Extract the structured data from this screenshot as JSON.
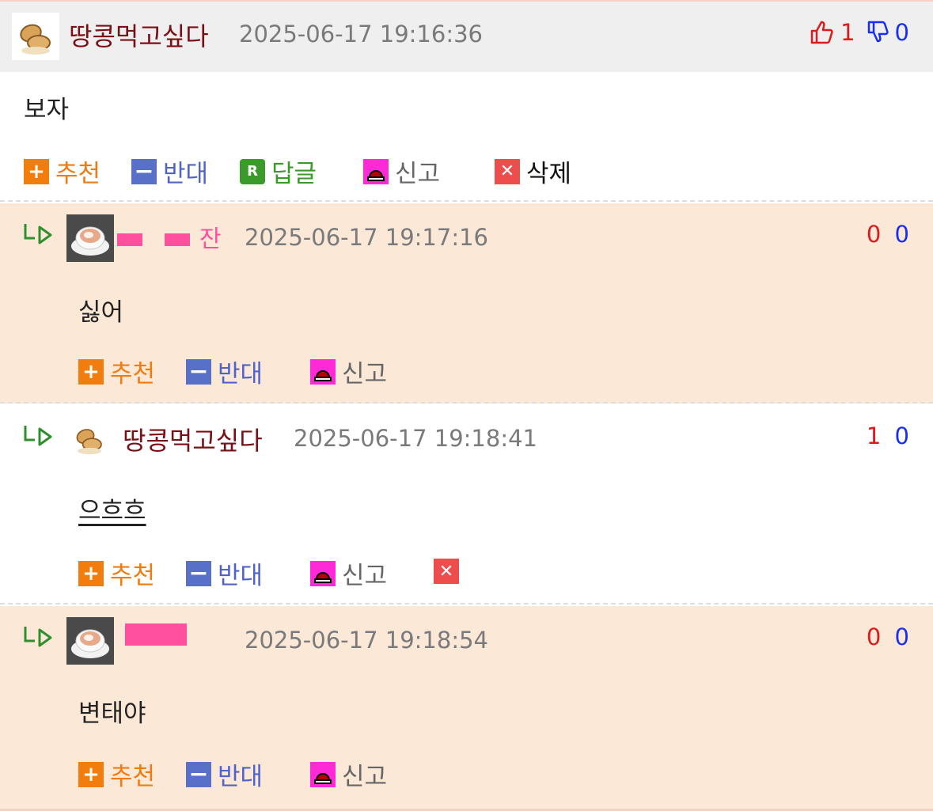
{
  "comments": [
    {
      "nick": "땅콩먹고싶다",
      "date": "2025-06-17 19:16:36",
      "up": "1",
      "down": "0",
      "text": "보자",
      "actions": {
        "recommend": "추천",
        "oppose": "반대",
        "reply": "답글",
        "report": "신고",
        "delete": "삭제"
      }
    },
    {
      "nick": "잔",
      "date": "2025-06-17 19:17:16",
      "up": "0",
      "down": "0",
      "text": "싫어",
      "actions": {
        "recommend": "추천",
        "oppose": "반대",
        "report": "신고"
      }
    },
    {
      "nick": "땅콩먹고싶다",
      "date": "2025-06-17 19:18:41",
      "up": "1",
      "down": "0",
      "text": "으흐흐",
      "actions": {
        "recommend": "추천",
        "oppose": "반대",
        "report": "신고"
      }
    },
    {
      "nick": "",
      "date": "2025-06-17 19:18:54",
      "up": "0",
      "down": "0",
      "text": "변태야",
      "actions": {
        "recommend": "추천",
        "oppose": "반대",
        "report": "신고"
      }
    }
  ],
  "icons": {
    "thumbs_up": "thumbs-up-icon",
    "thumbs_down": "thumbs-down-icon",
    "plus": "plus-icon",
    "minus": "minus-icon",
    "reply": "reply-icon",
    "report": "siren-icon",
    "delete": "close-icon",
    "reply_arrow": "reply-arrow-icon"
  }
}
